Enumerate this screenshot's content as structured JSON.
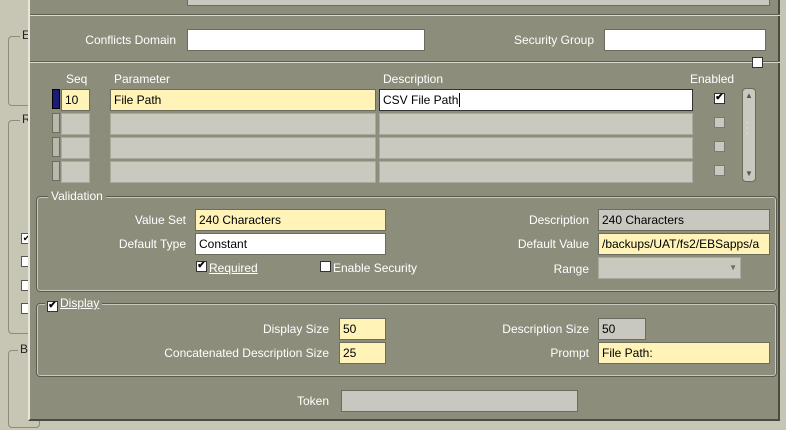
{
  "background_window": {
    "groups": [
      "E",
      "R",
      "B"
    ]
  },
  "header": {
    "conflicts_domain_label": "Conflicts Domain",
    "conflicts_domain_value": "",
    "security_group_label": "Security Group",
    "security_group_value": ""
  },
  "grid": {
    "col_seq": "Seq",
    "col_parameter": "Parameter",
    "col_description": "Description",
    "col_enabled": "Enabled",
    "rows": [
      {
        "seq": "10",
        "parameter": "File Path",
        "description": "CSV File Path",
        "enabled": "✔"
      },
      {
        "seq": "",
        "parameter": "",
        "description": "",
        "enabled": ""
      },
      {
        "seq": "",
        "parameter": "",
        "description": "",
        "enabled": ""
      },
      {
        "seq": "",
        "parameter": "",
        "description": "",
        "enabled": ""
      }
    ]
  },
  "validation": {
    "title": "Validation",
    "value_set_label": "Value Set",
    "value_set": "240 Characters",
    "description_label": "Description",
    "description": "240 Characters",
    "default_type_label": "Default Type",
    "default_type": "Constant",
    "default_value_label": "Default Value",
    "default_value": "/backups/UAT/fs2/EBSapps/a",
    "required_label": "Required",
    "required_checked": "✔",
    "enable_security_label": "Enable Security",
    "range_label": "Range",
    "range_value": ""
  },
  "display": {
    "title": "Display",
    "display_checked": "✔",
    "display_size_label": "Display Size",
    "display_size": "50",
    "description_size_label": "Description Size",
    "description_size": "50",
    "concat_size_label": "Concatenated Description Size",
    "concat_size": "25",
    "prompt_label": "Prompt",
    "prompt": "File Path:"
  },
  "token": {
    "label": "Token",
    "value": ""
  },
  "colors": {
    "dialog_bg": "#8d8d7c",
    "required_field": "#fff3b8",
    "active_row": "#1c1c78"
  }
}
